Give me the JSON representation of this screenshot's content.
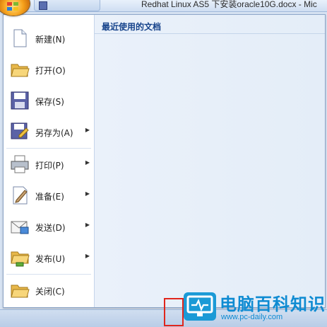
{
  "window": {
    "title": "Redhat Linux AS5 下安装oracle10G.docx - Mic"
  },
  "menu": {
    "items": [
      {
        "label": "新建(N)",
        "icon": "new-document-icon",
        "submenu": false
      },
      {
        "label": "打开(O)",
        "icon": "open-folder-icon",
        "submenu": false
      },
      {
        "label": "保存(S)",
        "icon": "save-disk-icon",
        "submenu": false
      },
      {
        "label": "另存为(A)",
        "icon": "save-as-icon",
        "submenu": true
      },
      {
        "label": "打印(P)",
        "icon": "printer-icon",
        "submenu": true
      },
      {
        "label": "准备(E)",
        "icon": "prepare-pen-icon",
        "submenu": true
      },
      {
        "label": "发送(D)",
        "icon": "send-mail-icon",
        "submenu": true
      },
      {
        "label": "发布(U)",
        "icon": "publish-folder-icon",
        "submenu": true
      },
      {
        "label": "关闭(C)",
        "icon": "close-folder-icon",
        "submenu": false
      }
    ],
    "recent_title": "最近使用的文档"
  },
  "watermark": {
    "title": "电脑百科知识",
    "url": "www.pc-daily.com"
  },
  "colors": {
    "accent": "#15428b",
    "highlight": "#e0261c",
    "watermark": "#1b9ad6"
  }
}
